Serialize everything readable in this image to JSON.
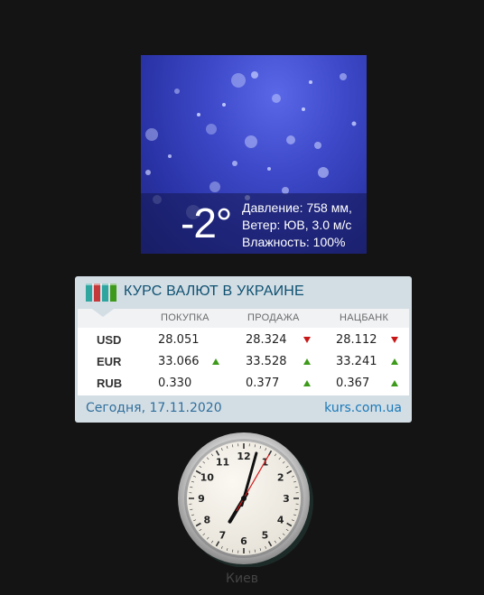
{
  "weather": {
    "temperature": "-2°",
    "pressure": "Давление: 758 мм,",
    "wind": "Ветер: ЮВ, 3.0 м/с",
    "humidity": "Влажность: 100%"
  },
  "rates": {
    "title": "КУРС ВАЛЮТ В УКРАИНЕ",
    "columns": [
      "ПОКУПКА",
      "ПРОДАЖА",
      "НАЦБАНК"
    ],
    "rows": [
      {
        "currency": "USD",
        "buy": "28.051",
        "sell": "28.324",
        "nbu": "28.112",
        "buy_trend": "none",
        "sell_trend": "down",
        "nbu_trend": "down"
      },
      {
        "currency": "EUR",
        "buy": "33.066",
        "sell": "33.528",
        "nbu": "33.241",
        "buy_trend": "up",
        "sell_trend": "up",
        "nbu_trend": "up"
      },
      {
        "currency": "RUB",
        "buy": "0.330",
        "sell": "0.377",
        "nbu": "0.367",
        "buy_trend": "none",
        "sell_trend": "up",
        "nbu_trend": "up"
      }
    ],
    "date": "Сегодня, 17.11.2020",
    "site": "kurs.com.ua",
    "colors": {
      "up": "#3d9a1a",
      "down": "#c81616",
      "accent": "#0e5171"
    }
  },
  "clock": {
    "numbers": [
      "12",
      "1",
      "2",
      "3",
      "4",
      "5",
      "6",
      "7",
      "8",
      "9",
      "10",
      "11"
    ],
    "time": {
      "hours": 7,
      "minutes": 2,
      "seconds": 35
    },
    "city": "Киев"
  }
}
